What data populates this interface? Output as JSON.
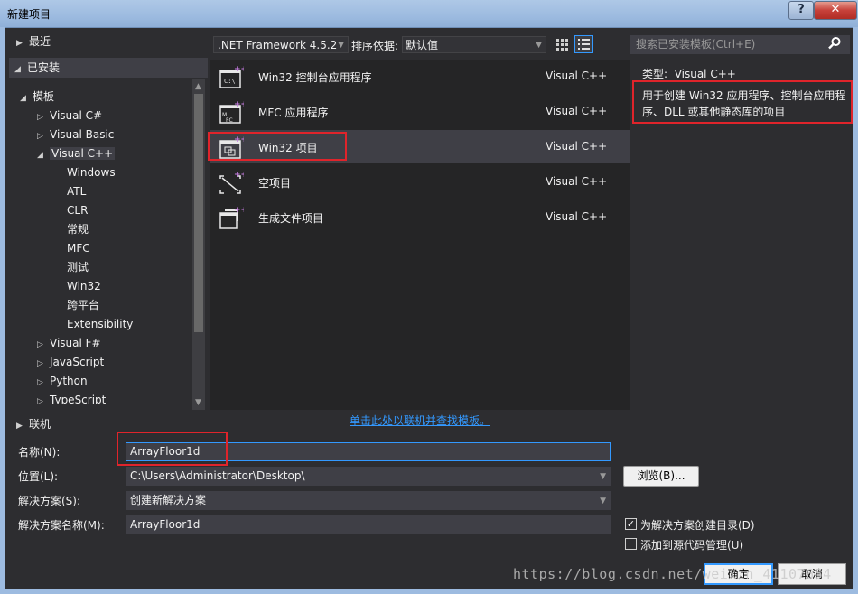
{
  "window": {
    "title": "新建项目",
    "help": "?",
    "close": "✕"
  },
  "tree": {
    "recent": "最近",
    "installed": "已安装",
    "templates": "模板",
    "items": [
      "Visual C#",
      "Visual Basic",
      "Visual C++",
      "Windows",
      "ATL",
      "CLR",
      "常规",
      "MFC",
      "测试",
      "Win32",
      "跨平台",
      "Extensibility",
      "Visual F#",
      "JavaScript",
      "Python",
      "TypeScript"
    ],
    "online": "联机"
  },
  "toolbar": {
    "framework": ".NET Framework 4.5.2",
    "sort_label": "排序依据:",
    "sort_value": "默认值",
    "search_placeholder": "搜索已安装模板(Ctrl+E)"
  },
  "templates": [
    {
      "name": "Win32 控制台应用程序",
      "lang": "Visual C++",
      "icon": "console-app-icon"
    },
    {
      "name": "MFC 应用程序",
      "lang": "Visual C++",
      "icon": "mfc-app-icon"
    },
    {
      "name": "Win32 项目",
      "lang": "Visual C++",
      "icon": "win32-project-icon",
      "selected": true
    },
    {
      "name": "空项目",
      "lang": "Visual C++",
      "icon": "empty-project-icon"
    },
    {
      "name": "生成文件项目",
      "lang": "Visual C++",
      "icon": "makefile-project-icon"
    }
  ],
  "online_link": "单击此处以联机并查找模板。",
  "description": {
    "type_label": "类型:",
    "type_value": "Visual C++",
    "text": "用于创建 Win32 应用程序、控制台应用程序、DLL 或其他静态库的项目"
  },
  "form": {
    "name_label": "名称(N):",
    "name_value": "ArrayFloor1d",
    "location_label": "位置(L):",
    "location_value": "C:\\Users\\Administrator\\Desktop\\",
    "solution_label": "解决方案(S):",
    "solution_value": "创建新解决方案",
    "solution_name_label": "解决方案名称(M):",
    "solution_name_value": "ArrayFloor1d",
    "browse": "浏览(B)...",
    "create_dir": "为解决方案创建目录(D)",
    "add_source_control": "添加到源代码管理(U)",
    "create_dir_checked": true,
    "add_source_control_checked": false
  },
  "buttons": {
    "ok": "确定",
    "cancel": "取消"
  },
  "watermark": "https://blog.csdn.net/weixin_41107654"
}
